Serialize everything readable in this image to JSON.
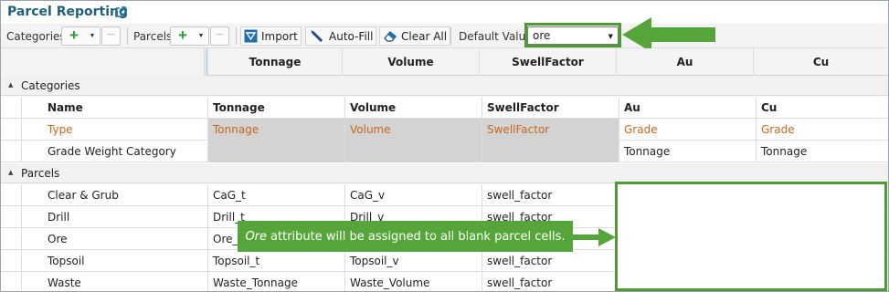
{
  "window": {
    "title": "Parcel Reporting"
  },
  "toolbar": {
    "categories_label": "Categories",
    "parcels_label": "Parcels",
    "import_label": "Import",
    "autofill_label": "Auto-Fill",
    "clear_all_label": "Clear All",
    "default_value_label": "Default Value",
    "default_value": "ore"
  },
  "grid": {
    "columns": [
      "Tonnage",
      "Volume",
      "SwellFactor",
      "Au",
      "Cu"
    ],
    "categories_group": "Categories",
    "parcels_group": "Parcels",
    "category_rows": [
      {
        "name": "Name",
        "cells": [
          "Tonnage",
          "Volume",
          "SwellFactor",
          "Au",
          "Cu"
        ]
      },
      {
        "name": "Type",
        "cells": [
          "Tonnage",
          "Volume",
          "SwellFactor",
          "Grade",
          "Grade"
        ]
      },
      {
        "name": "Grade Weight Category",
        "cells": [
          "",
          "",
          "",
          "Tonnage",
          "Tonnage"
        ]
      }
    ],
    "parcel_rows": [
      {
        "name": "Clear & Grub",
        "cells": [
          "CaG_t",
          "CaG_v",
          "swell_factor",
          "",
          ""
        ]
      },
      {
        "name": "Drill",
        "cells": [
          "Drill_t",
          "Drill_v",
          "swell_factor",
          "",
          ""
        ]
      },
      {
        "name": "Ore",
        "cells": [
          "Ore_To",
          "",
          "swell_factor",
          "",
          ""
        ]
      },
      {
        "name": "Topsoil",
        "cells": [
          "Topsoil_t",
          "Topsoil_v",
          "swell_factor",
          "",
          ""
        ]
      },
      {
        "name": "Waste",
        "cells": [
          "Waste_Tonnage",
          "Waste_Volume",
          "swell_factor",
          "",
          ""
        ]
      }
    ]
  },
  "annotation": {
    "callout_emphasis": "Ore",
    "callout_text": "attribute will be assigned to all blank parcel cells.",
    "accent_color": "#55a53a"
  },
  "colors": {
    "title": "#1f5f7a",
    "type_row_text": "#c9661e",
    "plus_icon": "#2e9a2e"
  }
}
